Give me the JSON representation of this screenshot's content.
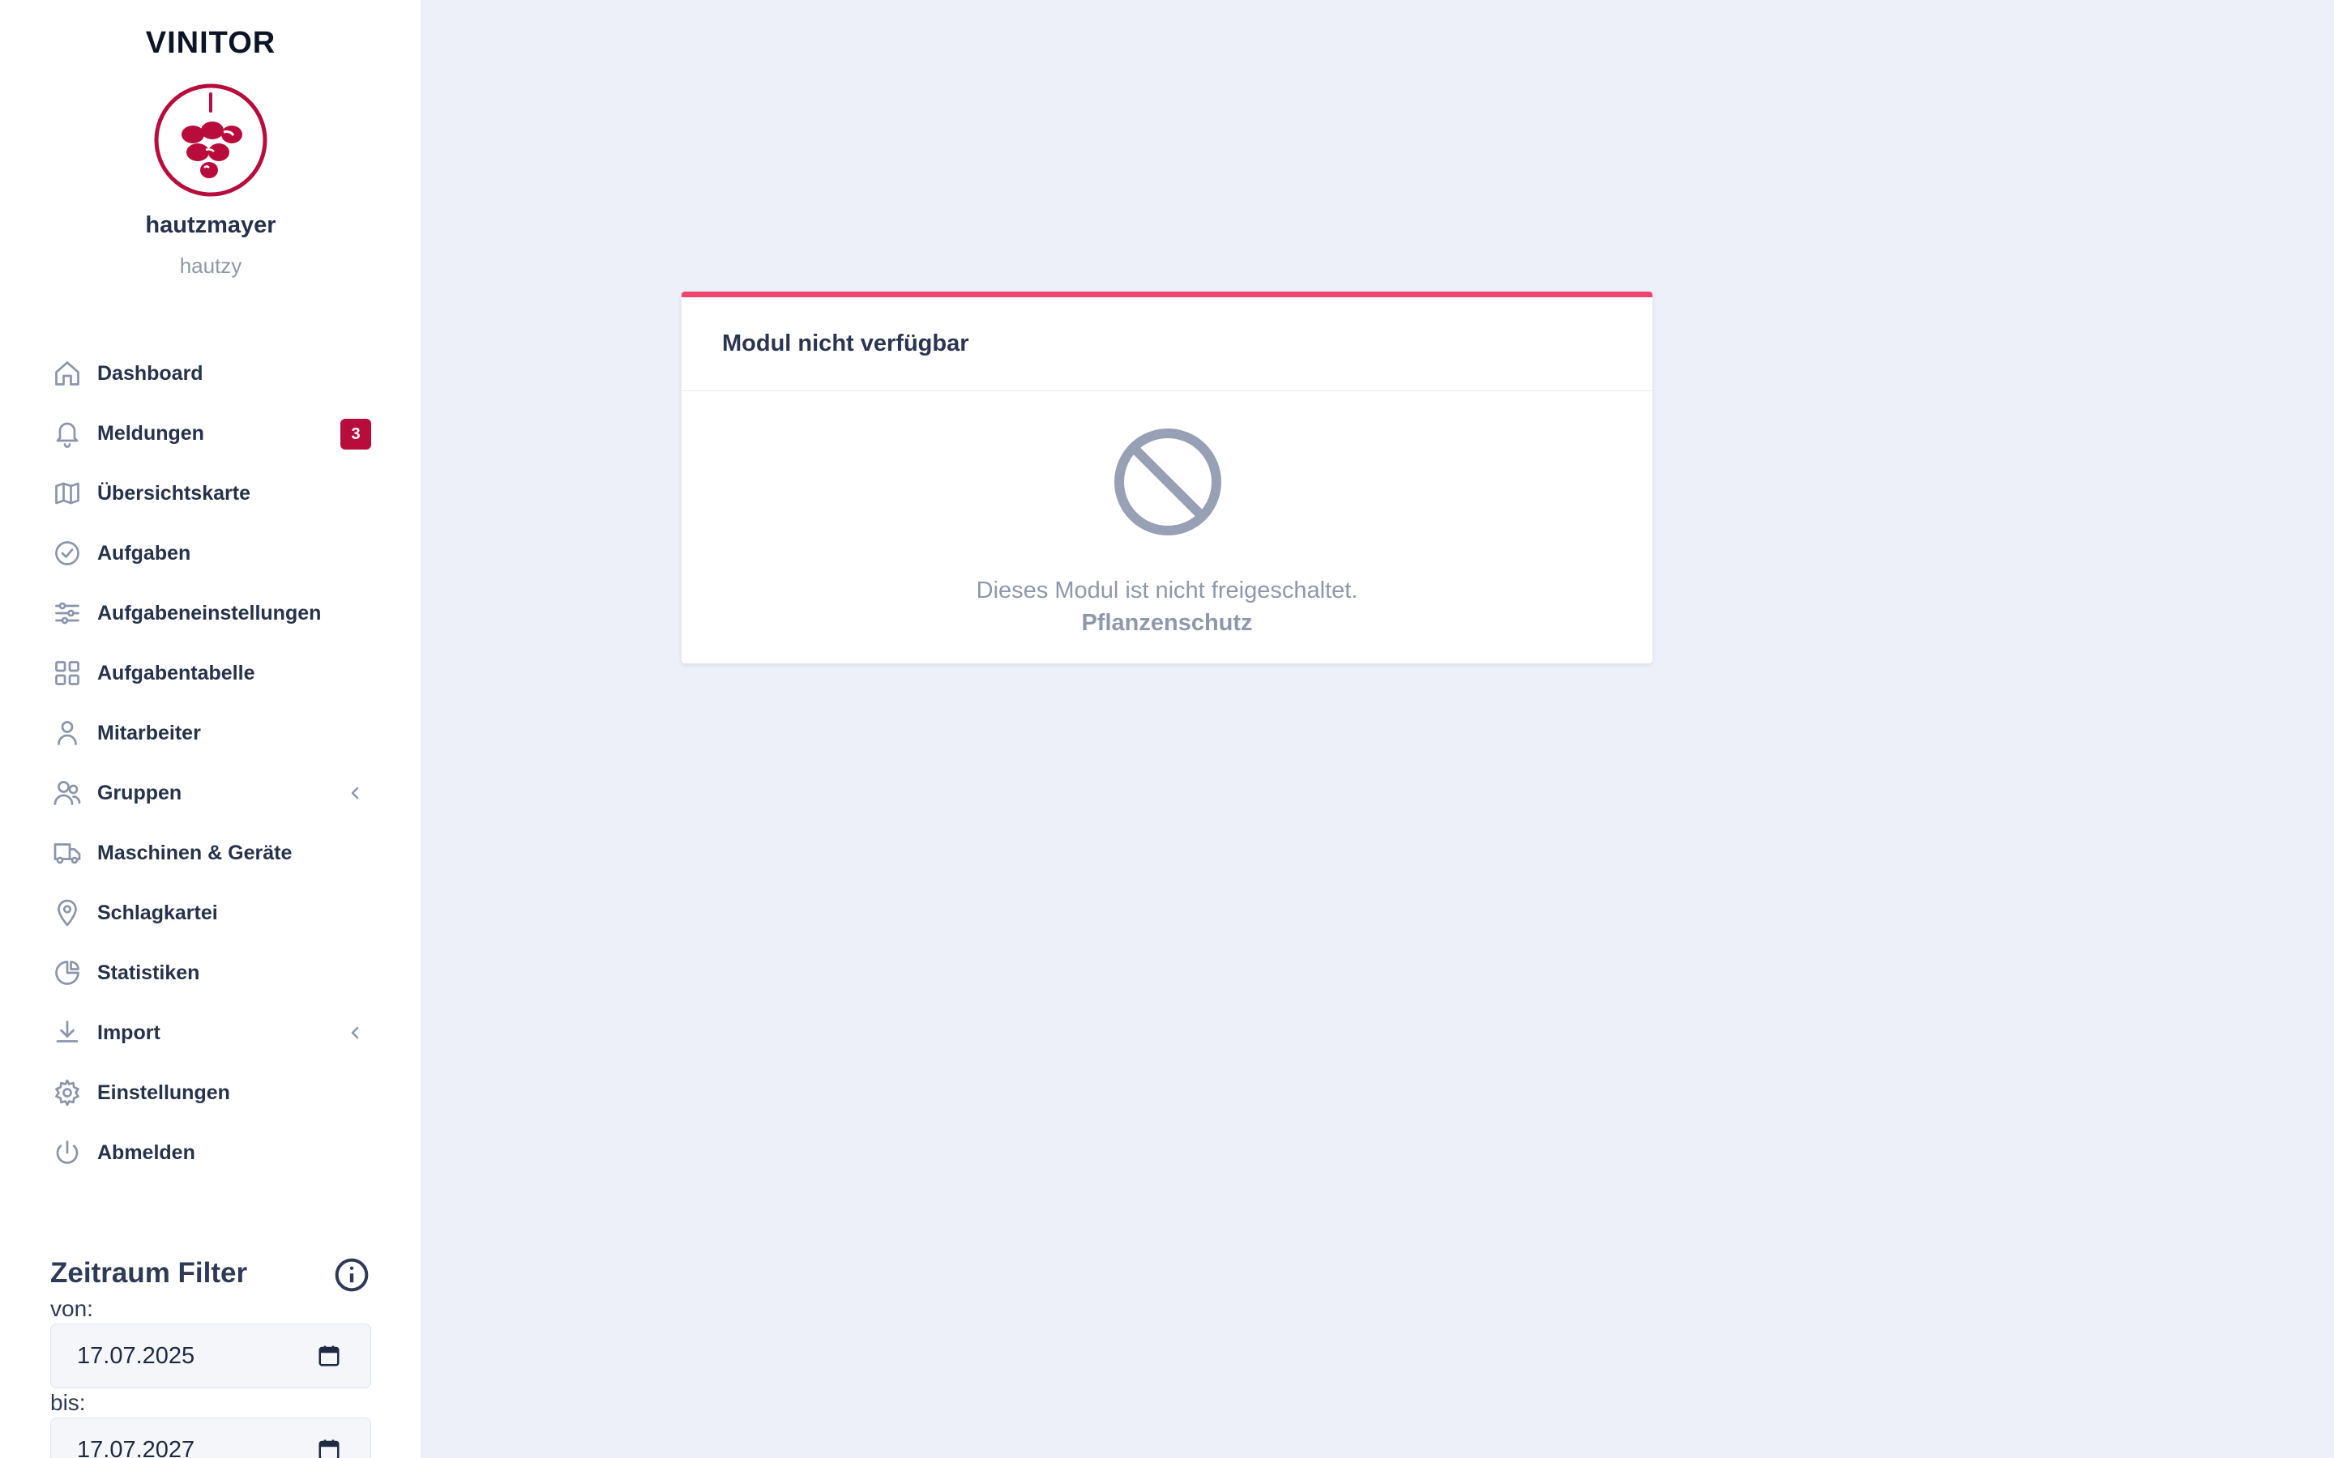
{
  "app": {
    "title": "VINITOR"
  },
  "user": {
    "name": "hautzmayer",
    "handle": "hautzy"
  },
  "nav": {
    "items": [
      {
        "label": "Dashboard",
        "icon": "home-icon"
      },
      {
        "label": "Meldungen",
        "icon": "bell-icon",
        "badge": "3"
      },
      {
        "label": "Übersichtskarte",
        "icon": "map-icon"
      },
      {
        "label": "Aufgaben",
        "icon": "check-circle-icon"
      },
      {
        "label": "Aufgabeneinstellungen",
        "icon": "sliders-icon"
      },
      {
        "label": "Aufgabentabelle",
        "icon": "grid-icon"
      },
      {
        "label": "Mitarbeiter",
        "icon": "user-icon"
      },
      {
        "label": "Gruppen",
        "icon": "users-icon",
        "expandable": true
      },
      {
        "label": "Maschinen & Geräte",
        "icon": "truck-icon"
      },
      {
        "label": "Schlagkartei",
        "icon": "map-pin-icon"
      },
      {
        "label": "Statistiken",
        "icon": "pie-chart-icon"
      },
      {
        "label": "Import",
        "icon": "download-icon",
        "expandable": true
      },
      {
        "label": "Einstellungen",
        "icon": "gear-icon"
      },
      {
        "label": "Abmelden",
        "icon": "power-icon"
      }
    ]
  },
  "filter": {
    "title": "Zeitraum Filter",
    "from_label": "von:",
    "from_value": "17.07.2025",
    "to_label": "bis:",
    "to_value": "17.07.2027"
  },
  "card": {
    "title": "Modul nicht verfügbar",
    "message": "Dieses Modul ist nicht freigeschaltet.",
    "module": "Pflanzenschutz"
  },
  "colors": {
    "accent_bar": "#ee4470",
    "badge": "#b80d3c",
    "background": "#edf0f8",
    "logo": "#b80d3c"
  }
}
